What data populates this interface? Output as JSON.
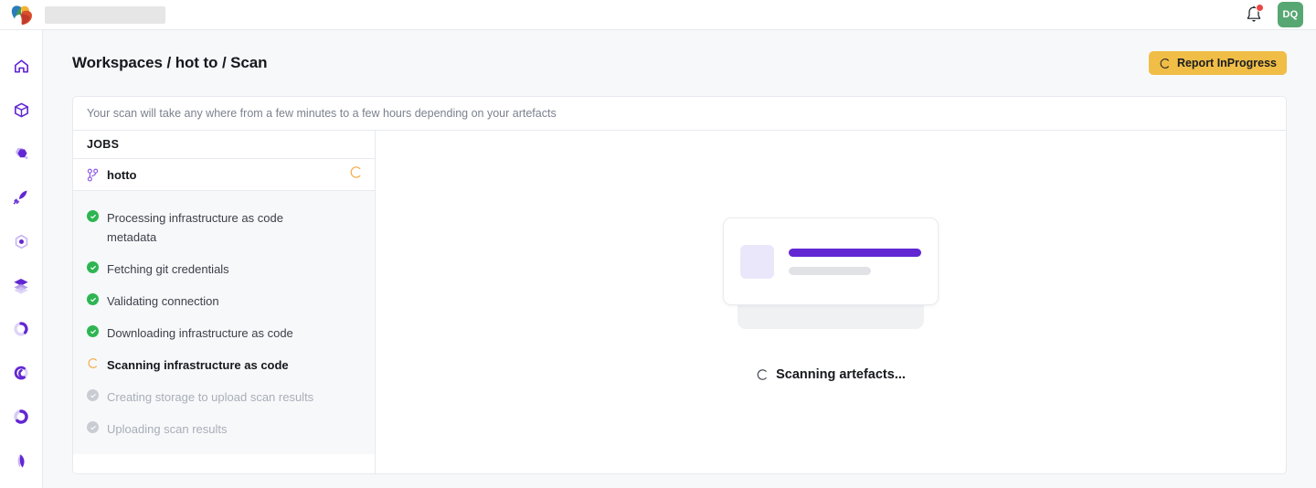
{
  "topbar": {
    "logo_icon": "brand-leaf-logo",
    "workspace_placeholder": "",
    "bell_icon": "notification-bell-icon",
    "has_notification": true,
    "avatar_initials": "DQ",
    "avatar_color": "#57a773"
  },
  "sidebar": {
    "items": [
      {
        "icon": "home-icon",
        "name": "sidebar-item-home"
      },
      {
        "icon": "cube-icon",
        "name": "sidebar-item-assets"
      },
      {
        "icon": "hexagon-filled-icon",
        "name": "sidebar-item-resources"
      },
      {
        "icon": "rocket-icon",
        "name": "sidebar-item-deploy"
      },
      {
        "icon": "hexagon-dot-icon",
        "name": "sidebar-item-modules"
      },
      {
        "icon": "layers-icon",
        "name": "sidebar-item-stacks"
      },
      {
        "icon": "donut-chart-icon",
        "name": "sidebar-item-reports"
      },
      {
        "icon": "spiral-icon",
        "name": "sidebar-item-insights"
      },
      {
        "icon": "ring-icon",
        "name": "sidebar-item-policies"
      },
      {
        "icon": "petal-icon",
        "name": "sidebar-item-settings"
      }
    ]
  },
  "header": {
    "breadcrumb": "Workspaces / hot to / Scan",
    "status_button_label": "Report InProgress",
    "status_button_icon": "spinner-icon",
    "status_button_color": "#f0bd47"
  },
  "banner": {
    "message": "Your scan will take any where from a few minutes to a few hours depending on your artefacts"
  },
  "jobs_panel": {
    "title": "JOBS",
    "job": {
      "icon": "git-branch-icon",
      "name": "hotto",
      "status_icon": "spinner-icon"
    },
    "steps": [
      {
        "label": "Processing infrastructure as code metadata",
        "state": "done",
        "icon": "check-circle-icon"
      },
      {
        "label": "Fetching git credentials",
        "state": "done",
        "icon": "check-circle-icon"
      },
      {
        "label": "Validating connection",
        "state": "done",
        "icon": "check-circle-icon"
      },
      {
        "label": "Downloading infrastructure as code",
        "state": "done",
        "icon": "check-circle-icon"
      },
      {
        "label": "Scanning infrastructure as code",
        "state": "active",
        "icon": "spinner-icon"
      },
      {
        "label": "Creating storage to upload scan results",
        "state": "pending",
        "icon": "check-circle-muted-icon"
      },
      {
        "label": "Uploading scan results",
        "state": "pending",
        "icon": "check-circle-muted-icon"
      }
    ]
  },
  "preview": {
    "skeleton_icon": "placeholder-card",
    "status_text": "Scanning artefacts...",
    "status_icon": "spinner-icon",
    "accent_color": "#6227d3"
  }
}
